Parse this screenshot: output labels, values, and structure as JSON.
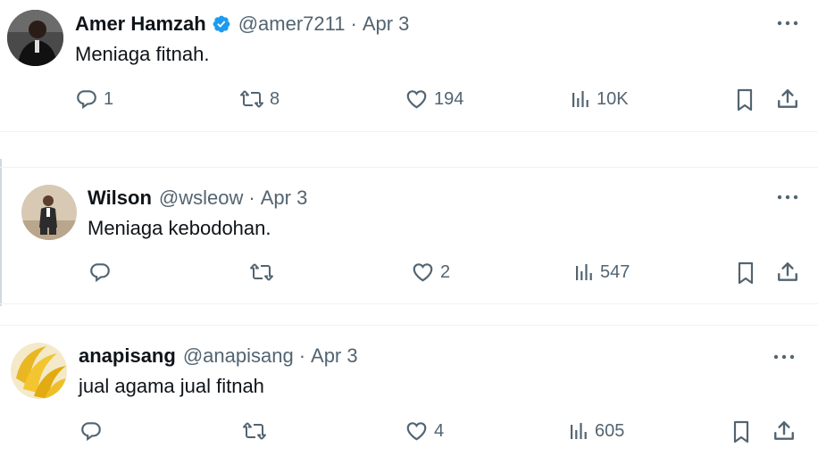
{
  "tweets": [
    {
      "name": "Amer Hamzah",
      "verified": true,
      "handle": "@amer7211",
      "separator": "·",
      "date": "Apr 3",
      "text": "Meniaga fitnah.",
      "replies": "1",
      "retweets": "8",
      "likes": "194",
      "views": "10K",
      "avatar": "man-in-dark-suit-avatar"
    },
    {
      "name": "Wilson",
      "verified": false,
      "handle": "@wsleow",
      "separator": "·",
      "date": "Apr 3",
      "text": "Meniaga kebodohan.",
      "replies": "",
      "retweets": "",
      "likes": "2",
      "views": "547",
      "avatar": "man-seated-avatar"
    },
    {
      "name": "anapisang",
      "verified": false,
      "handle": "@anapisang",
      "separator": "·",
      "date": "Apr 3",
      "text": "jual agama jual fitnah",
      "replies": "",
      "retweets": "",
      "likes": "4",
      "views": "605",
      "avatar": "banana-avatar"
    }
  ],
  "colors": {
    "text": "#0f1419",
    "secondary": "#536471",
    "verified": "#1d9bf0",
    "divider": "#eff3f4"
  },
  "icons": [
    "reply-icon",
    "retweet-icon",
    "like-icon",
    "views-icon",
    "bookmark-icon",
    "share-icon",
    "more-icon",
    "verified-badge-icon"
  ]
}
